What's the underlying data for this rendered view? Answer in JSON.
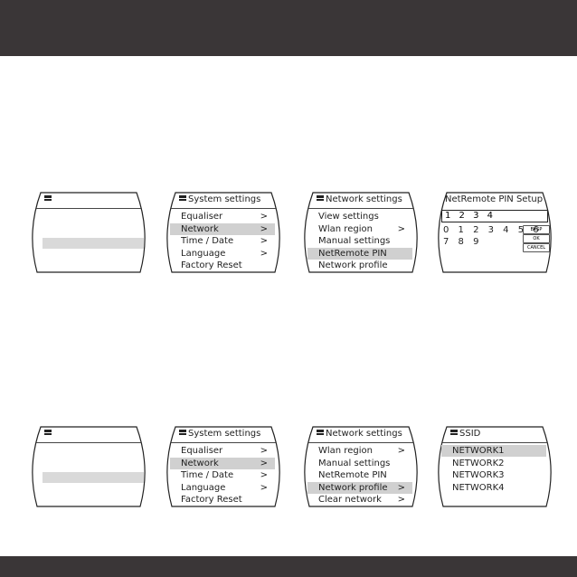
{
  "row1": {
    "screen1": {
      "title": ""
    },
    "screen2": {
      "title": "System settings",
      "items": [
        {
          "label": "Equaliser",
          "chevron": ">"
        },
        {
          "label": "Network",
          "chevron": ">",
          "selected": true
        },
        {
          "label": "Time / Date",
          "chevron": ">"
        },
        {
          "label": "Language",
          "chevron": ">"
        },
        {
          "label": "Factory Reset",
          "chevron": ""
        }
      ]
    },
    "screen3": {
      "title": "Network settings",
      "items": [
        {
          "label": "View settings",
          "chevron": ""
        },
        {
          "label": "Wlan region",
          "chevron": ">"
        },
        {
          "label": "Manual settings",
          "chevron": ""
        },
        {
          "label": "NetRemote PIN",
          "chevron": "",
          "selected": true
        },
        {
          "label": "Network profile",
          "chevron": ""
        }
      ]
    },
    "screen4": {
      "title": "NetRemote PIN Setup",
      "pin": "1 2 3 4",
      "digits_row1": "0 1 2 3 4 5 6",
      "digits_row2": "7 8 9",
      "buttons": [
        "BKSP",
        "OK",
        "CANCEL"
      ]
    }
  },
  "row2": {
    "screen1": {
      "title": ""
    },
    "screen2": {
      "title": "System settings",
      "items": [
        {
          "label": "Equaliser",
          "chevron": ">"
        },
        {
          "label": "Network",
          "chevron": ">",
          "selected": true
        },
        {
          "label": "Time / Date",
          "chevron": ">"
        },
        {
          "label": "Language",
          "chevron": ">"
        },
        {
          "label": "Factory Reset",
          "chevron": ""
        }
      ]
    },
    "screen3": {
      "title": "Network settings",
      "items": [
        {
          "label": "Wlan region",
          "chevron": ">"
        },
        {
          "label": "Manual settings",
          "chevron": ""
        },
        {
          "label": "NetRemote PIN",
          "chevron": ""
        },
        {
          "label": "Network profile",
          "chevron": ">",
          "selected": true
        },
        {
          "label": "Clear network",
          "chevron": ">"
        }
      ]
    },
    "screen4": {
      "title": "SSID",
      "items": [
        {
          "label": "NETWORK1",
          "selected": true
        },
        {
          "label": "NETWORK2"
        },
        {
          "label": "NETWORK3"
        },
        {
          "label": "NETWORK4"
        }
      ]
    }
  },
  "colors": {
    "band": "#3a3637",
    "highlight": "#d0d0d0"
  }
}
